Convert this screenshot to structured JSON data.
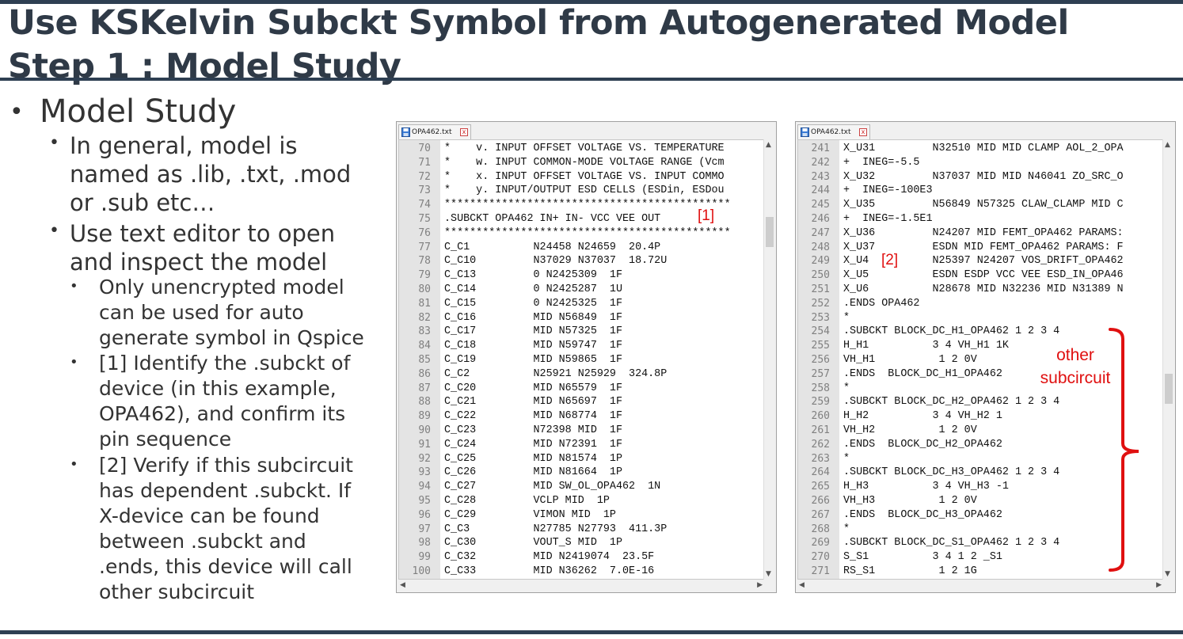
{
  "slide": {
    "title_line1": "Use KSKelvin Subckt Symbol from Autogenerated Model",
    "title_line2": "Step 1 : Model Study"
  },
  "bullets": {
    "level1_bullet": "•",
    "level1": "Model Study",
    "level2_bullet": "•",
    "level2": [
      [
        "In general, model is",
        "named as .lib, .txt, .mod",
        "or .sub etc…"
      ],
      [
        "Use text editor to open",
        "and inspect the model"
      ]
    ],
    "level3_bullet": "•",
    "level3": [
      [
        "Only unencrypted model",
        "can be used for auto",
        "generate symbol in Qspice"
      ],
      [
        "[1] Identify the .subckt of",
        "device (in this example,",
        "OPA462), and confirm its",
        "pin sequence"
      ],
      [
        "[2] Verify if this subcircuit",
        "has dependent .subckt.  If",
        "X-device can be found",
        "between .subckt and",
        ".ends, this device will call",
        "other subcircuit"
      ]
    ]
  },
  "editor_left": {
    "tab_label": "OPA462.txt",
    "tab_close": "x",
    "line_numbers": [
      "70",
      "71",
      "72",
      "73",
      "74",
      "75",
      "76",
      "77",
      "78",
      "79",
      "80",
      "81",
      "82",
      "83",
      "84",
      "85",
      "86",
      "87",
      "88",
      "89",
      "90",
      "91",
      "92",
      "93",
      "94",
      "95",
      "96",
      "97",
      "98",
      "99",
      "100"
    ],
    "lines": [
      "*    v. INPUT OFFSET VOLTAGE VS. TEMPERATURE",
      "*    w. INPUT COMMON-MODE VOLTAGE RANGE (Vcm",
      "*    x. INPUT OFFSET VOLTAGE VS. INPUT COMMO",
      "*    y. INPUT/OUTPUT ESD CELLS (ESDin, ESDou",
      "*********************************************",
      ".SUBCKT OPA462 IN+ IN- VCC VEE OUT",
      "*********************************************",
      "C_C1          N24458 N24659  20.4P",
      "C_C10         N37029 N37037  18.72U",
      "C_C13         0 N2425309  1F",
      "C_C14         0 N2425287  1U",
      "C_C15         0 N2425325  1F",
      "C_C16         MID N56849  1F",
      "C_C17         MID N57325  1F",
      "C_C18         MID N59747  1F",
      "C_C19         MID N59865  1F",
      "C_C2          N25921 N25929  324.8P",
      "C_C20         MID N65579  1F",
      "C_C21         MID N65697  1F",
      "C_C22         MID N68774  1F",
      "C_C23         N72398 MID  1F",
      "C_C24         MID N72391  1F",
      "C_C25         MID N81574  1P",
      "C_C26         MID N81664  1P",
      "C_C27         MID SW_OL_OPA462  1N",
      "C_C28         VCLP MID  1P",
      "C_C29         VIMON MID  1P",
      "C_C3          N27785 N27793  411.3P",
      "C_C30         VOUT_S MID  1P",
      "C_C32         MID N2419074  23.5F",
      "C_C33         MID N36262  7.0E-16"
    ],
    "annotation": "[1]"
  },
  "editor_right": {
    "tab_label": "OPA462.txt",
    "tab_close": "x",
    "line_numbers": [
      "241",
      "242",
      "243",
      "244",
      "245",
      "246",
      "247",
      "248",
      "249",
      "250",
      "251",
      "252",
      "253",
      "254",
      "255",
      "256",
      "257",
      "258",
      "259",
      "260",
      "261",
      "262",
      "263",
      "264",
      "265",
      "266",
      "267",
      "268",
      "269",
      "270",
      "271"
    ],
    "lines": [
      "X_U31         N32510 MID MID CLAMP AOL_2_OPA",
      "+  INEG=-5.5",
      "X_U32         N37037 MID MID N46041 ZO_SRC_O",
      "+  INEG=-100E3",
      "X_U35         N56849 N57325 CLAW_CLAMP MID C",
      "+  INEG=-1.5E1",
      "X_U36         N24207 MID FEMT_OPA462 PARAMS:",
      "X_U37         ESDN MID FEMT_OPA462 PARAMS: F",
      "X_U4          N25397 N24207 VOS_DRIFT_OPA462",
      "X_U5          ESDN ESDP VCC VEE ESD_IN_OPA46",
      "X_U6          N28678 MID N32236 MID N31389 N",
      ".ENDS OPA462",
      "*",
      ".SUBCKT BLOCK_DC_H1_OPA462 1 2 3 4",
      "H_H1          3 4 VH_H1 1K",
      "VH_H1          1 2 0V",
      ".ENDS  BLOCK_DC_H1_OPA462",
      "*",
      ".SUBCKT BLOCK_DC_H2_OPA462 1 2 3 4",
      "H_H2          3 4 VH_H2 1",
      "VH_H2          1 2 0V",
      ".ENDS  BLOCK_DC_H2_OPA462",
      "*",
      ".SUBCKT BLOCK_DC_H3_OPA462 1 2 3 4",
      "H_H3          3 4 VH_H3 -1",
      "VH_H3          1 2 0V",
      ".ENDS  BLOCK_DC_H3_OPA462",
      "*",
      ".SUBCKT BLOCK_DC_S1_OPA462 1 2 3 4",
      "S_S1          3 4 1 2 _S1",
      "RS_S1          1 2 1G"
    ],
    "annotation": "[2]",
    "brace_label_line1": "other",
    "brace_label_line2": "subcircuit"
  },
  "colors": {
    "title_bar": "#2e3f52",
    "annotation_red": "#e01010"
  }
}
